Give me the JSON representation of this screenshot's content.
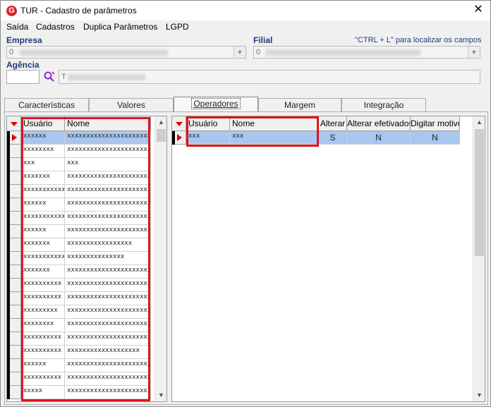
{
  "window": {
    "title": "TUR - Cadastro de parâmetros",
    "icon_letter": "G",
    "close_glyph": "✕"
  },
  "menu": [
    {
      "label": "Saída",
      "accel": "S"
    },
    {
      "label": "Cadastros",
      "accel": "C"
    },
    {
      "label": "Duplica Parâmetros",
      "accel": "D"
    },
    {
      "label": "LGPD",
      "accel": "L"
    }
  ],
  "empresa": {
    "label": "Empresa",
    "value": "0"
  },
  "filial": {
    "label": "Filial",
    "value": "0"
  },
  "hint": "\"CTRL + L\" para localizar os campos",
  "agencia": {
    "label": "Agência",
    "code_prefix": "T"
  },
  "tabs": [
    {
      "label": "Características",
      "active": false
    },
    {
      "label": "Valores",
      "active": false
    },
    {
      "label": "Operadores",
      "active": true
    },
    {
      "label": "Margem",
      "active": false
    },
    {
      "label": "Integração",
      "active": false
    }
  ],
  "left_grid": {
    "columns": [
      "Usuário",
      "Nome"
    ],
    "rows": [
      [
        "xxxxxx",
        "xxxxxxxxxxxxxxxxxxxxxxxxxxxxxxx"
      ],
      [
        "xxxxxxxx",
        "xxxxxxxxxxxxxxxxxxxxxxxxxxx"
      ],
      [
        "xxx",
        "xxx"
      ],
      [
        "xxxxxxx",
        "xxxxxxxxxxxxxxxxxxxxxxxxxx"
      ],
      [
        "xxxxxxxxxxx...",
        "xxxxxxxxxxxxxxxxxxxxxxxxxxx"
      ],
      [
        "xxxxxx",
        "xxxxxxxxxxxxxxxxxxxxxxxxxx"
      ],
      [
        "xxxxxxxxxxx",
        "xxxxxxxxxxxxxxxxxxxxxxxx"
      ],
      [
        "xxxxxx",
        "xxxxxxxxxxxxxxxxxxxxxxxx"
      ],
      [
        "xxxxxxx",
        "xxxxxxxxxxxxxxxxx"
      ],
      [
        "xxxxxxxxxxx",
        "xxxxxxxxxxxxxxx"
      ],
      [
        "xxxxxxx",
        "xxxxxxxxxxxxxxxxxxxxxxxxxx"
      ],
      [
        "xxxxxxxxxx",
        "xxxxxxxxxxxxxxxxxxxxxxxxxxxxxx..."
      ],
      [
        "xxxxxxxxxx",
        "xxxxxxxxxxxxxxxxxxxxxxxxxxxxxxx"
      ],
      [
        "xxxxxxxxx",
        "xxxxxxxxxxxxxxxxxxxxxxxxx"
      ],
      [
        "xxxxxxxx",
        "xxxxxxxxxxxxxxxxxxxxxxxxxxxxx..."
      ],
      [
        "xxxxxxxxxx",
        "xxxxxxxxxxxxxxxxxxxxxxxxxxxxx..."
      ],
      [
        "xxxxxxxxxx",
        "xxxxxxxxxxxxxxxxxxx"
      ],
      [
        "xxxxxx",
        "xxxxxxxxxxxxxxxxxxxxxxxxxxxxx..."
      ],
      [
        "xxxxxxxxxx",
        "xxxxxxxxxxxxxxxxxxxxxxxxxx"
      ],
      [
        "xxxxx",
        "xxxxxxxxxxxxxxxxxxxxxxxxxxxxx..."
      ]
    ]
  },
  "right_grid": {
    "columns": [
      "Usuário",
      "Nome",
      "Alterar",
      "Alterar efetivados",
      "Digitar motivo"
    ],
    "rows": [
      [
        "xxx",
        "xxx",
        "S",
        "N",
        "N"
      ]
    ]
  },
  "colors": {
    "highlight": "#e0141b",
    "selection": "#a9c6ee",
    "label_blue": "#1f3b78"
  }
}
